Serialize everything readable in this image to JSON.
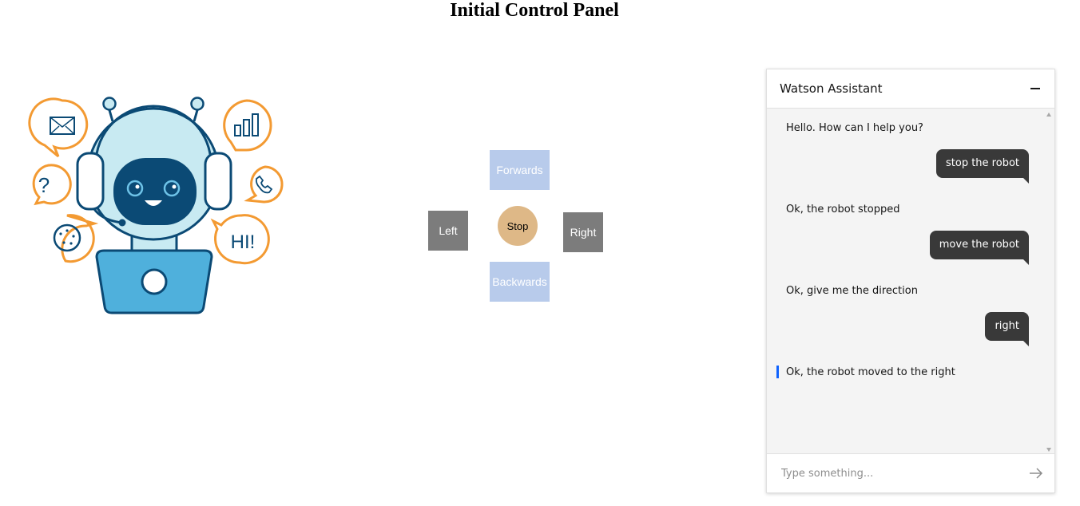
{
  "page": {
    "title": "Initial Control Panel"
  },
  "controls": {
    "forwards": "Forwards",
    "left": "Left",
    "stop": "Stop",
    "right": "Right",
    "backwards": "Backwards"
  },
  "illustration": {
    "bubble_hi_text": "HI!",
    "bubble_question_text": "?"
  },
  "chat": {
    "title": "Watson Assistant",
    "messages": [
      {
        "from": "bot",
        "text": "Hello. How can I help you?"
      },
      {
        "from": "user",
        "text": "stop the robot"
      },
      {
        "from": "bot",
        "text": "Ok, the robot stopped"
      },
      {
        "from": "user",
        "text": "move the robot"
      },
      {
        "from": "bot",
        "text": "Ok, give me the direction"
      },
      {
        "from": "user",
        "text": "right"
      },
      {
        "from": "bot",
        "text": "Ok, the robot moved to the right"
      }
    ],
    "input_placeholder": "Type something..."
  },
  "colors": {
    "direction_light": "#b8cbeb",
    "direction_gray": "#7c7c7c",
    "stop": "#deb887",
    "user_bubble": "#393939",
    "accent_orange": "#f39a32",
    "robot_navy": "#0b4a75"
  }
}
